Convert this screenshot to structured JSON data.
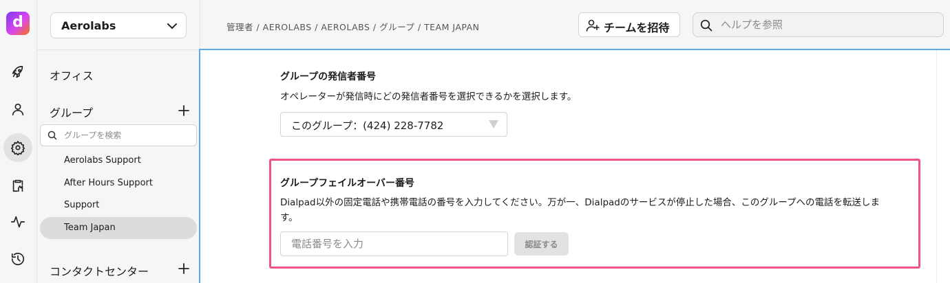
{
  "rail": {
    "logo_letter": "d",
    "icons": [
      "rocket-icon",
      "person-icon",
      "gear-icon",
      "document-hand-icon",
      "activity-icon",
      "history-icon"
    ]
  },
  "sidebar": {
    "org_name": "Aerolabs",
    "office_label": "オフィス",
    "groups_label": "グループ",
    "group_search_placeholder": "グループを検索",
    "groups": [
      "Aerolabs Support",
      "After Hours Support",
      "Support",
      "Team Japan"
    ],
    "contact_center_label": "コンタクトセンター"
  },
  "header": {
    "breadcrumb": "管理者 / AEROLABS / AEROLABS / グループ / TEAM JAPAN",
    "invite_label": "チームを招待",
    "help_placeholder": "ヘルプを参照"
  },
  "main": {
    "caller_id_title": "グループの発信者番号",
    "caller_id_desc": "オペレーターが発信時にどの発信者番号を選択できるかを選択します。",
    "caller_id_value": "このグループ：(424) 228-7782",
    "failover_title": "グループフェイルオーバー番号",
    "failover_desc": "Dialpad以外の固定電話や携帯電話の番号を入力してください。万が一、Dialpadのサービスが停止した場合、このグループへの電話を転送しま",
    "failover_desc_cont": "す。",
    "phone_placeholder": "電話番号を入力",
    "verify_label": "認証する"
  },
  "colors": {
    "highlight": "#f0538a",
    "focus_border": "#5aa9ea"
  }
}
